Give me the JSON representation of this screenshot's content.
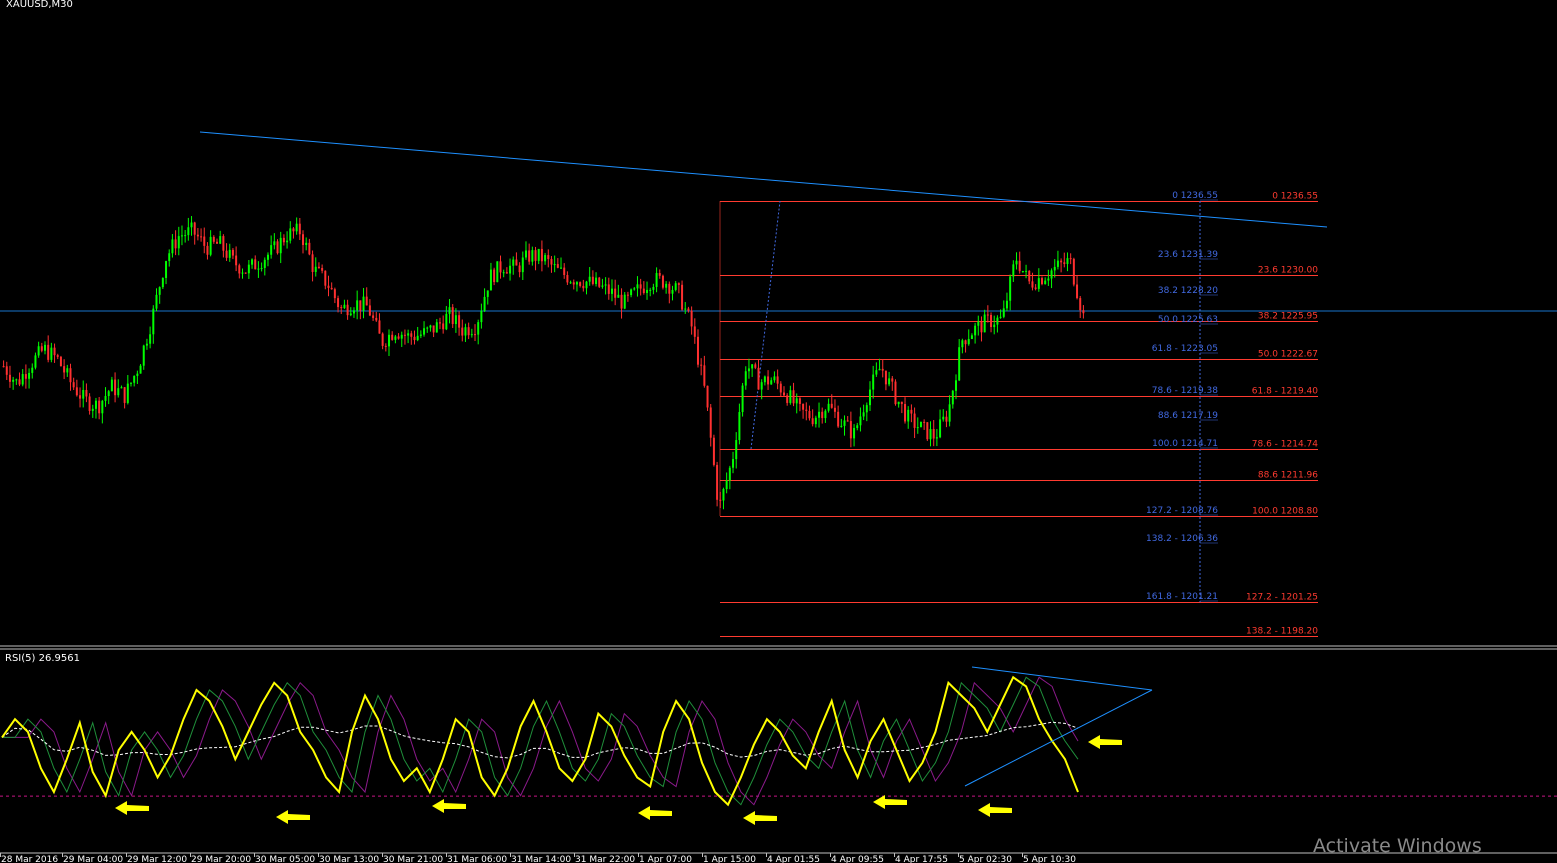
{
  "window": {
    "symbol_title": "XAUUSD,M30"
  },
  "indicator": {
    "label": "RSI(5) 26.9561"
  },
  "watermark": "Activate Windows",
  "colors": {
    "background": "#000000",
    "bull_candle": "#00ff00",
    "bear_candle": "#ff3030",
    "trendline": "#1e90ff",
    "fib_a": "#ff3b30",
    "fib_b": "#4169e1",
    "rsi_line": "#ffff00",
    "arrow": "#ffff00"
  },
  "chart_data": {
    "type": "candlestick",
    "timeframe": "M30",
    "x_tick_labels": [
      "28 Mar 2016",
      "29 Mar 04:00",
      "29 Mar 12:00",
      "29 Mar 20:00",
      "30 Mar 05:00",
      "30 Mar 13:00",
      "30 Mar 21:00",
      "31 Mar 06:00",
      "31 Mar 14:00",
      "31 Mar 22:00",
      "1 Apr 07:00",
      "1 Apr 15:00",
      "4 Apr 01:55",
      "4 Apr 09:55",
      "4 Apr 17:55",
      "5 Apr 02:30",
      "5 Apr 10:30"
    ],
    "price_path": [
      1222.0,
      1220.5,
      1222.2,
      1223.5,
      1222.6,
      1220.5,
      1219.0,
      1218.5,
      1220.2,
      1219.4,
      1222.0,
      1226.2,
      1231.5,
      1233.5,
      1233.9,
      1232.5,
      1232.8,
      1231.2,
      1230.4,
      1231.3,
      1232.2,
      1233.6,
      1233.9,
      1230.5,
      1229.3,
      1227.0,
      1227.6,
      1227.2,
      1224.1,
      1225.2,
      1224.6,
      1224.8,
      1225.4,
      1226.5,
      1225.2,
      1225.6,
      1229.8,
      1230.9,
      1230.6,
      1231.8,
      1231.5,
      1230.4,
      1229.8,
      1229.5,
      1229.1,
      1228.5,
      1227.5,
      1228.7,
      1229.6,
      1229.5,
      1228.5,
      1225.4,
      1219.5,
      1209.4,
      1213.8,
      1222.2,
      1220.6,
      1220.8,
      1219.6,
      1218.0,
      1217.5,
      1218.6,
      1217.2,
      1216.0,
      1219.5,
      1222.0,
      1219.5,
      1217.4,
      1216.5,
      1215.8,
      1218.0,
      1224.3,
      1225.3,
      1226.0,
      1226.1,
      1231.6,
      1229.3,
      1229.9,
      1230.7,
      1231.3,
      1226.4
    ],
    "fibonacci_a": {
      "color": "#ff3b30",
      "levels": [
        {
          "label": "0 1236.55",
          "price": 1236.55
        },
        {
          "label": "23.6 1230.00",
          "price": 1230.0
        },
        {
          "label": "38.2 1225.95",
          "price": 1225.95
        },
        {
          "label": "50.0 1222.67",
          "price": 1222.67
        },
        {
          "label": "61.8 - 1219.40",
          "price": 1219.4
        },
        {
          "label": "78.6 - 1214.74",
          "price": 1214.74
        },
        {
          "label": "88.6 1211.96",
          "price": 1211.96
        },
        {
          "label": "100.0 1208.80",
          "price": 1208.8
        },
        {
          "label": "127.2 - 1201.25",
          "price": 1201.25
        },
        {
          "label": "138.2 - 1198.20",
          "price": 1198.2
        }
      ]
    },
    "fibonacci_b": {
      "color": "#4169e1",
      "levels": [
        {
          "label": "0 1236.55",
          "price": 1236.55
        },
        {
          "label": "23.6 1231.39",
          "price": 1231.39
        },
        {
          "label": "38.2 1228.20",
          "price": 1228.2
        },
        {
          "label": "50.0 1225.63",
          "price": 1225.63
        },
        {
          "label": "61.8 - 1223.05",
          "price": 1223.05
        },
        {
          "label": "78.6 - 1219.38",
          "price": 1219.38
        },
        {
          "label": "88.6 1217.19",
          "price": 1217.19
        },
        {
          "label": "100.0 1214.71",
          "price": 1214.71
        },
        {
          "label": "127.2 - 1208.76",
          "price": 1208.76
        },
        {
          "label": "138.2 - 1206.36",
          "price": 1206.36
        },
        {
          "label": "161.8 - 1201.21",
          "price": 1201.21
        }
      ]
    },
    "rsi": {
      "period": 5,
      "last_value": 26.9561,
      "series": [
        52,
        62,
        55,
        35,
        22,
        40,
        60,
        33,
        20,
        45,
        55,
        45,
        30,
        42,
        62,
        78,
        72,
        58,
        40,
        55,
        70,
        82,
        75,
        55,
        45,
        30,
        22,
        55,
        75,
        62,
        40,
        28,
        35,
        22,
        40,
        62,
        55,
        30,
        20,
        35,
        58,
        72,
        55,
        35,
        28,
        40,
        65,
        58,
        42,
        30,
        25,
        55,
        72,
        62,
        38,
        22,
        15,
        30,
        48,
        62,
        55,
        42,
        35,
        55,
        72,
        45,
        30,
        50,
        62,
        45,
        28,
        38,
        55,
        82,
        75,
        68,
        55,
        70,
        85,
        80,
        62,
        50,
        40,
        22
      ]
    }
  }
}
